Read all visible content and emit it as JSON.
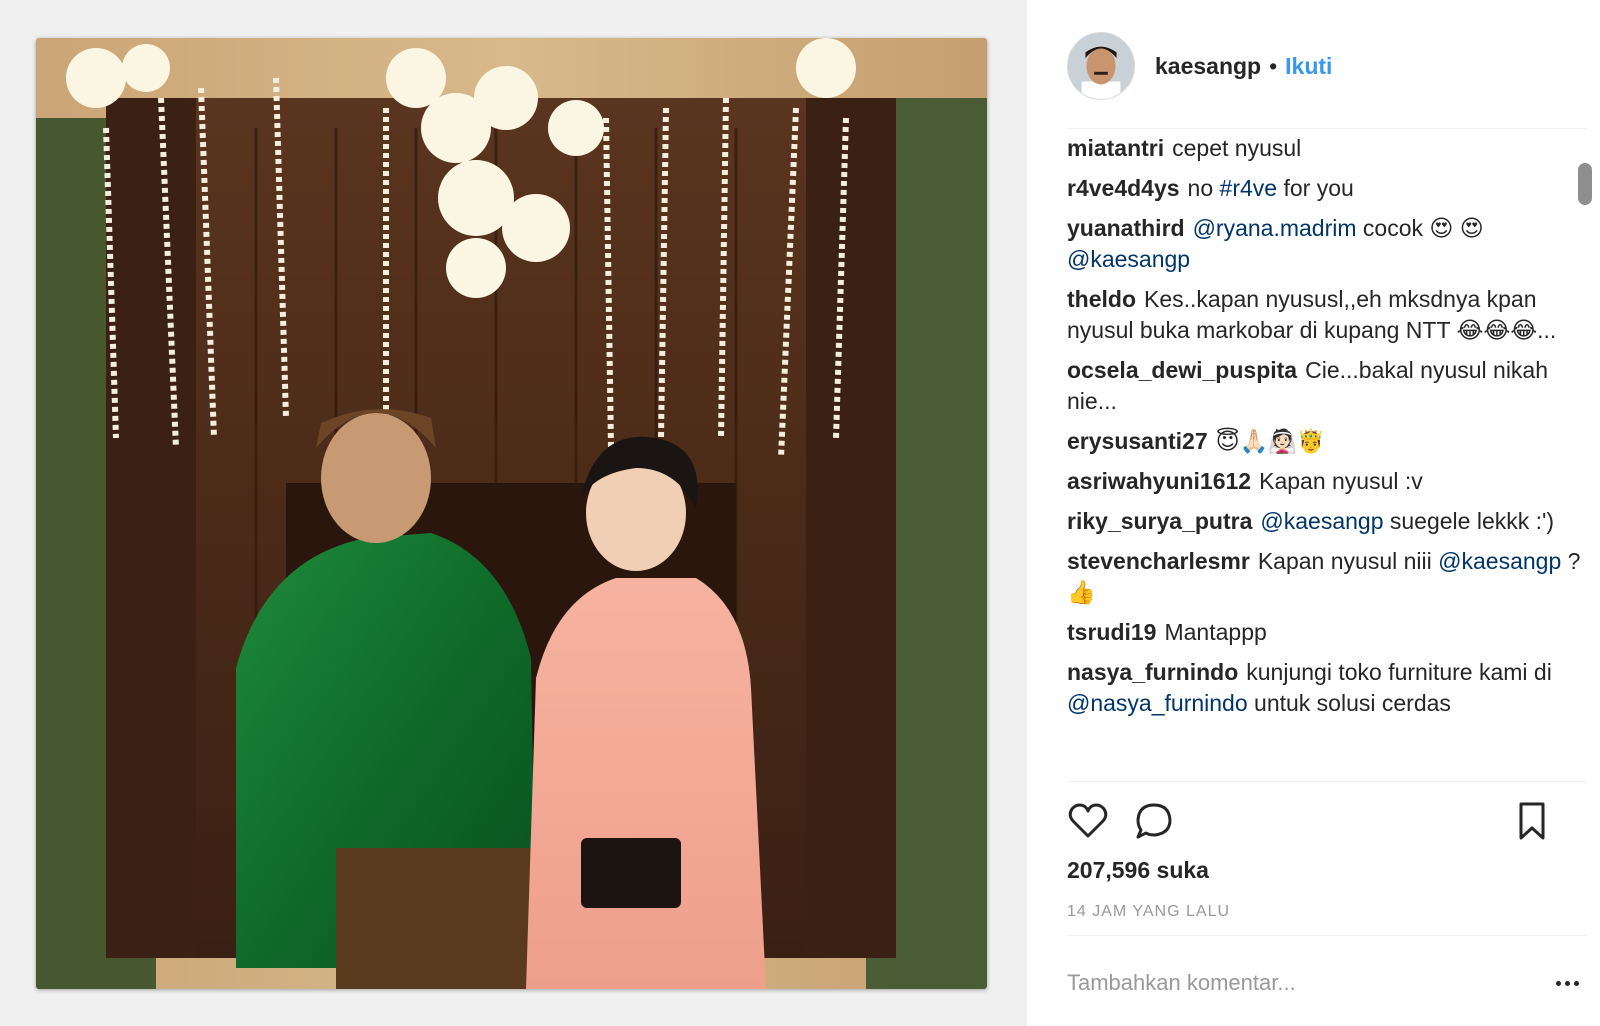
{
  "post": {
    "username": "kaesangp",
    "separator": "•",
    "follow_label": "Ikuti",
    "likes": "207,596 suka",
    "timestamp": "14 JAM YANG LALU",
    "comment_placeholder": "Tambahkan komentar..."
  },
  "comments": [
    {
      "author": "miatantri",
      "parts": [
        {
          "t": "text",
          "v": "cepet nyusul"
        }
      ]
    },
    {
      "author": "r4ve4d4ys",
      "parts": [
        {
          "t": "text",
          "v": "no "
        },
        {
          "t": "mention",
          "v": "#r4ve"
        },
        {
          "t": "text",
          "v": " for you"
        }
      ]
    },
    {
      "author": "yuanathird",
      "parts": [
        {
          "t": "mention",
          "v": "@ryana.madrim"
        },
        {
          "t": "text",
          "v": " cocok 😍 😍 "
        },
        {
          "t": "mention",
          "v": "@kaesangp"
        }
      ]
    },
    {
      "author": "theldo",
      "parts": [
        {
          "t": "text",
          "v": "Kes..kapan nyususl,,eh mksdnya kpan nyusul buka markobar di kupang NTT 😂😂😂..."
        }
      ]
    },
    {
      "author": "ocsela_dewi_puspita",
      "parts": [
        {
          "t": "text",
          "v": "Cie...bakal nyusul nikah nie..."
        }
      ]
    },
    {
      "author": "erysusanti27",
      "parts": [
        {
          "t": "text",
          "v": "😇🙏🏻👰🏻🤴"
        }
      ]
    },
    {
      "author": "asriwahyuni1612",
      "parts": [
        {
          "t": "text",
          "v": "Kapan nyusul :v"
        }
      ]
    },
    {
      "author": "riky_surya_putra",
      "parts": [
        {
          "t": "mention",
          "v": "@kaesangp"
        },
        {
          "t": "text",
          "v": " suegele lekkk :')"
        }
      ]
    },
    {
      "author": "stevencharlesmr",
      "parts": [
        {
          "t": "text",
          "v": "Kapan nyusul niii "
        },
        {
          "t": "mention",
          "v": "@kaesangp"
        },
        {
          "t": "text",
          "v": " ?👍"
        }
      ]
    },
    {
      "author": "tsrudi19",
      "parts": [
        {
          "t": "text",
          "v": "Mantappp"
        }
      ]
    },
    {
      "author": "nasya_furnindo",
      "parts": [
        {
          "t": "text",
          "v": "kunjungi toko furniture kami di "
        },
        {
          "t": "mention",
          "v": "@nasya_furnindo"
        },
        {
          "t": "text",
          "v": " untuk solusi cerdas"
        }
      ]
    }
  ],
  "icons": {
    "like": "heart-icon",
    "comment": "comment-icon",
    "save": "bookmark-icon",
    "more": "more-options-icon"
  },
  "colors": {
    "accent": "#3897f0",
    "mention": "#003569",
    "muted": "#999999",
    "text": "#262626"
  }
}
